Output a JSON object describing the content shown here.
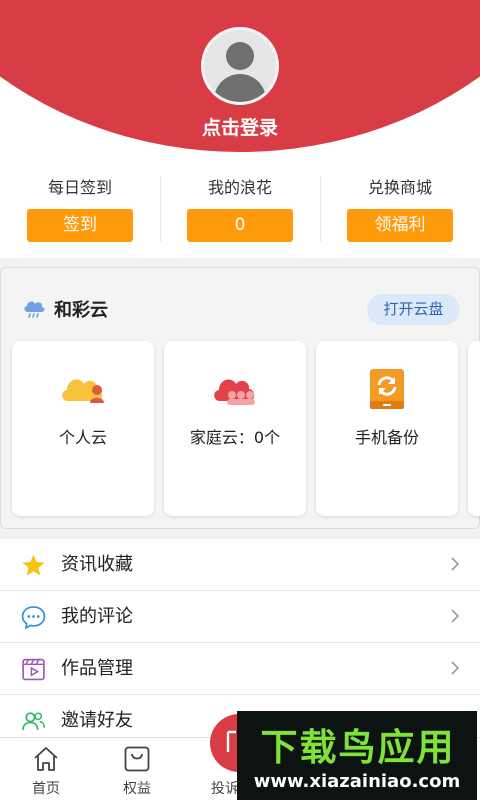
{
  "header": {
    "login_label": "点击登录"
  },
  "stats": [
    {
      "label": "每日签到",
      "button": "签到"
    },
    {
      "label": "我的浪花",
      "button": "0"
    },
    {
      "label": "兑换商城",
      "button": "领福利"
    }
  ],
  "cloud": {
    "title": "和彩云",
    "open_label": "打开云盘",
    "tiles": [
      {
        "label": "个人云",
        "icon": "personal-cloud-icon"
      },
      {
        "label": "家庭云：0个",
        "icon": "family-cloud-icon"
      },
      {
        "label": "手机备份",
        "icon": "phone-backup-icon"
      }
    ]
  },
  "menu": [
    {
      "label": "资讯收藏",
      "icon": "star-icon"
    },
    {
      "label": "我的评论",
      "icon": "comment-icon"
    },
    {
      "label": "作品管理",
      "icon": "video-icon"
    },
    {
      "label": "邀请好友",
      "icon": "friends-icon"
    }
  ],
  "tabbar": {
    "home": "首页",
    "benefits": "权益",
    "complaint": "投诉"
  },
  "watermark": {
    "main": "下载鸟应用",
    "sub": "www.xiazainiao.com"
  },
  "colors": {
    "brand_red": "#d83c44",
    "accent_orange": "#ff9a0a",
    "link_blue": "#2f66b3"
  }
}
